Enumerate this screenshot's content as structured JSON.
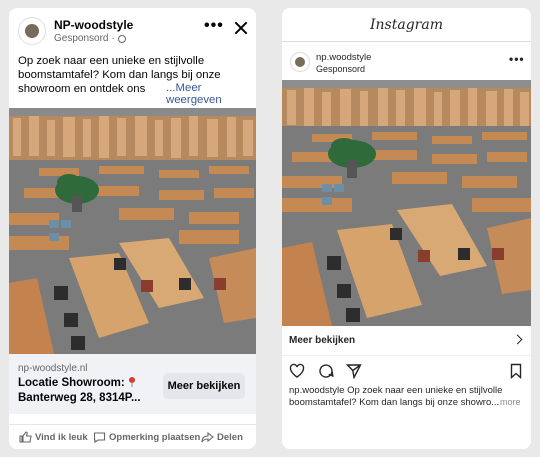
{
  "facebook": {
    "page_name": "NP-woodstyle",
    "sponsored": "Gesponsord",
    "post_text": "Op zoek naar een unieke en stijlvolle boomstamtafel? Kom dan langs bij onze showroom en ontdek ons",
    "see_more": "...Meer weergeven",
    "link": {
      "domain": "np-woodstyle.nl",
      "headline_line1": "Locatie Showroom:",
      "headline_line2": "Banterweg 28, 8314P...",
      "cta": "Meer bekijken"
    },
    "actions": {
      "like": "Vind ik leuk",
      "comment": "Opmerking plaatsen",
      "share": "Delen"
    },
    "icons": [
      "globe-icon",
      "more-options-icon",
      "close-icon",
      "pin-icon",
      "like-icon",
      "comment-icon",
      "share-icon"
    ]
  },
  "instagram": {
    "app_title": "Instagram",
    "account": "np.woodstyle",
    "sponsored": "Gesponsord",
    "cta": "Meer bekijken",
    "caption": "np.woodstyle Op zoek naar een unieke en stijlvolle boomstamtafel? Kom dan langs bij onze showro...",
    "caption_more": "more",
    "icons": [
      "heart-icon",
      "comment-icon",
      "send-icon",
      "bookmark-icon",
      "chevron-right-icon"
    ]
  },
  "colors": {
    "fb_link_blue": "#385898",
    "fb_gray_text": "#65676b",
    "fb_button_bg": "#e4e6eb",
    "wood": "#b9794a"
  }
}
